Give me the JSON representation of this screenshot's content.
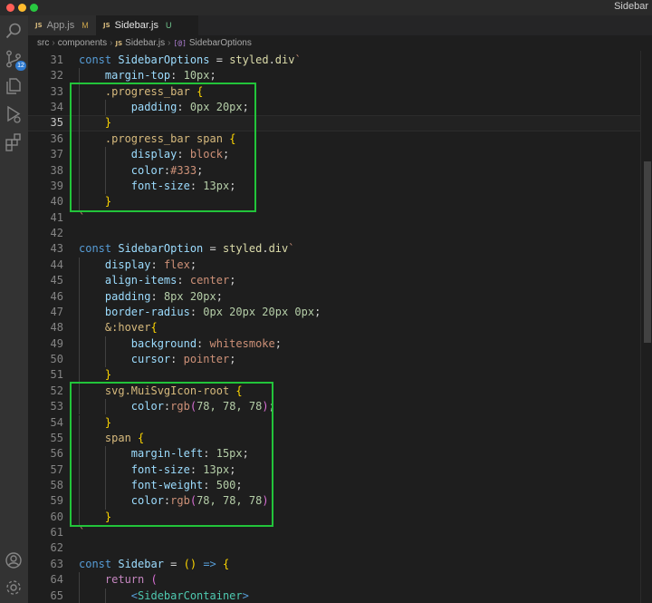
{
  "window": {
    "title": "Sidebar"
  },
  "activity_bar": {
    "icons": [
      "files-icon",
      "search-icon",
      "source-control-icon",
      "run-debug-icon",
      "extensions-icon",
      "account-icon",
      "gear-icon"
    ],
    "source_control_badge": "12"
  },
  "tabs": [
    {
      "label": "App.js",
      "status": "M",
      "active": false
    },
    {
      "label": "Sidebar.js",
      "status": "U",
      "active": true
    }
  ],
  "breadcrumb": {
    "items": [
      "src",
      "components",
      "Sidebar.js",
      "SidebarOptions"
    ]
  },
  "editor": {
    "current_line": 35,
    "lines": [
      {
        "n": "31",
        "indent": 0,
        "tokens": [
          [
            "kw",
            "const "
          ],
          [
            "name",
            "SidebarOptions"
          ],
          [
            "op",
            " = "
          ],
          [
            "func",
            "styled"
          ],
          [
            "op",
            "."
          ],
          [
            "func",
            "div"
          ],
          [
            "tmpl",
            "`"
          ]
        ]
      },
      {
        "n": "32",
        "indent": 1,
        "tokens": [
          [
            "css-prop",
            "margin-top"
          ],
          [
            "plain",
            ": "
          ],
          [
            "num",
            "10px"
          ],
          [
            "plain",
            ";"
          ]
        ]
      },
      {
        "n": "33",
        "indent": 1,
        "tokens": [
          [
            "css-sel",
            ".progress_bar"
          ],
          [
            "plain",
            " "
          ],
          [
            "brace",
            "{"
          ]
        ]
      },
      {
        "n": "34",
        "indent": 2,
        "tokens": [
          [
            "css-prop",
            "padding"
          ],
          [
            "plain",
            ": "
          ],
          [
            "num",
            "0px 20px"
          ],
          [
            "plain",
            ";"
          ]
        ]
      },
      {
        "n": "35",
        "indent": 1,
        "tokens": [
          [
            "brace",
            "}"
          ]
        ]
      },
      {
        "n": "36",
        "indent": 1,
        "tokens": [
          [
            "css-sel",
            ".progress_bar span"
          ],
          [
            "plain",
            " "
          ],
          [
            "brace",
            "{"
          ]
        ]
      },
      {
        "n": "37",
        "indent": 2,
        "tokens": [
          [
            "css-prop",
            "display"
          ],
          [
            "plain",
            ": "
          ],
          [
            "css-val",
            "block"
          ],
          [
            "plain",
            ";"
          ]
        ]
      },
      {
        "n": "38",
        "indent": 2,
        "tokens": [
          [
            "css-prop",
            "color"
          ],
          [
            "plain",
            ":"
          ],
          [
            "css-val",
            "#333"
          ],
          [
            "plain",
            ";"
          ]
        ]
      },
      {
        "n": "39",
        "indent": 2,
        "tokens": [
          [
            "css-prop",
            "font-size"
          ],
          [
            "plain",
            ": "
          ],
          [
            "num",
            "13px"
          ],
          [
            "plain",
            ";"
          ]
        ]
      },
      {
        "n": "40",
        "indent": 1,
        "tokens": [
          [
            "brace",
            "}"
          ]
        ]
      },
      {
        "n": "41",
        "indent": 0,
        "tokens": [
          [
            "tmpl",
            "`"
          ]
        ]
      },
      {
        "n": "42",
        "indent": 0,
        "tokens": []
      },
      {
        "n": "43",
        "indent": 0,
        "tokens": [
          [
            "kw",
            "const "
          ],
          [
            "name",
            "SidebarOption"
          ],
          [
            "op",
            " = "
          ],
          [
            "func",
            "styled"
          ],
          [
            "op",
            "."
          ],
          [
            "func",
            "div"
          ],
          [
            "tmpl",
            "`"
          ]
        ]
      },
      {
        "n": "44",
        "indent": 1,
        "tokens": [
          [
            "css-prop",
            "display"
          ],
          [
            "plain",
            ": "
          ],
          [
            "css-val",
            "flex"
          ],
          [
            "plain",
            ";"
          ]
        ]
      },
      {
        "n": "45",
        "indent": 1,
        "tokens": [
          [
            "css-prop",
            "align-items"
          ],
          [
            "plain",
            ": "
          ],
          [
            "css-val",
            "center"
          ],
          [
            "plain",
            ";"
          ]
        ]
      },
      {
        "n": "46",
        "indent": 1,
        "tokens": [
          [
            "css-prop",
            "padding"
          ],
          [
            "plain",
            ": "
          ],
          [
            "num",
            "8px 20px"
          ],
          [
            "plain",
            ";"
          ]
        ]
      },
      {
        "n": "47",
        "indent": 1,
        "tokens": [
          [
            "css-prop",
            "border-radius"
          ],
          [
            "plain",
            ": "
          ],
          [
            "num",
            "0px 20px 20px 0px"
          ],
          [
            "plain",
            ";"
          ]
        ]
      },
      {
        "n": "48",
        "indent": 1,
        "tokens": [
          [
            "css-sel",
            "&:hover"
          ],
          [
            "brace",
            "{"
          ]
        ]
      },
      {
        "n": "49",
        "indent": 2,
        "tokens": [
          [
            "css-prop",
            "background"
          ],
          [
            "plain",
            ": "
          ],
          [
            "css-val",
            "whitesmoke"
          ],
          [
            "plain",
            ";"
          ]
        ]
      },
      {
        "n": "50",
        "indent": 2,
        "tokens": [
          [
            "css-prop",
            "cursor"
          ],
          [
            "plain",
            ": "
          ],
          [
            "css-val",
            "pointer"
          ],
          [
            "plain",
            ";"
          ]
        ]
      },
      {
        "n": "51",
        "indent": 1,
        "tokens": [
          [
            "brace",
            "}"
          ]
        ]
      },
      {
        "n": "52",
        "indent": 1,
        "tokens": [
          [
            "css-sel",
            "svg.MuiSvgIcon-root"
          ],
          [
            "plain",
            " "
          ],
          [
            "brace",
            "{"
          ]
        ]
      },
      {
        "n": "53",
        "indent": 2,
        "tokens": [
          [
            "css-prop",
            "color"
          ],
          [
            "plain",
            ":"
          ],
          [
            "css-val",
            "rgb"
          ],
          [
            "paren",
            "("
          ],
          [
            "num",
            "78, 78, 78"
          ],
          [
            "paren",
            ")"
          ],
          [
            "plain",
            ";"
          ]
        ]
      },
      {
        "n": "54",
        "indent": 1,
        "tokens": [
          [
            "brace",
            "}"
          ]
        ]
      },
      {
        "n": "55",
        "indent": 1,
        "tokens": [
          [
            "css-sel",
            "span"
          ],
          [
            "plain",
            " "
          ],
          [
            "brace",
            "{"
          ]
        ]
      },
      {
        "n": "56",
        "indent": 2,
        "tokens": [
          [
            "css-prop",
            "margin-left"
          ],
          [
            "plain",
            ": "
          ],
          [
            "num",
            "15px"
          ],
          [
            "plain",
            ";"
          ]
        ]
      },
      {
        "n": "57",
        "indent": 2,
        "tokens": [
          [
            "css-prop",
            "font-size"
          ],
          [
            "plain",
            ": "
          ],
          [
            "num",
            "13px"
          ],
          [
            "plain",
            ";"
          ]
        ]
      },
      {
        "n": "58",
        "indent": 2,
        "tokens": [
          [
            "css-prop",
            "font-weight"
          ],
          [
            "plain",
            ": "
          ],
          [
            "num",
            "500"
          ],
          [
            "plain",
            ";"
          ]
        ]
      },
      {
        "n": "59",
        "indent": 2,
        "tokens": [
          [
            "css-prop",
            "color"
          ],
          [
            "plain",
            ":"
          ],
          [
            "css-val",
            "rgb"
          ],
          [
            "paren",
            "("
          ],
          [
            "num",
            "78, 78, 78"
          ],
          [
            "paren",
            ")"
          ]
        ]
      },
      {
        "n": "60",
        "indent": 1,
        "tokens": [
          [
            "brace",
            "}"
          ]
        ]
      },
      {
        "n": "61",
        "indent": 0,
        "tokens": [
          [
            "tmpl",
            "`"
          ]
        ]
      },
      {
        "n": "62",
        "indent": 0,
        "tokens": []
      },
      {
        "n": "63",
        "indent": 0,
        "tokens": [
          [
            "kw",
            "const "
          ],
          [
            "name",
            "Sidebar"
          ],
          [
            "op",
            " = "
          ],
          [
            "brace",
            "()"
          ],
          [
            "op",
            " "
          ],
          [
            "kw",
            "=>"
          ],
          [
            "op",
            " "
          ],
          [
            "brace",
            "{"
          ]
        ]
      },
      {
        "n": "64",
        "indent": 1,
        "tokens": [
          [
            "ctrl",
            "return"
          ],
          [
            "plain",
            " "
          ],
          [
            "paren",
            "("
          ]
        ]
      },
      {
        "n": "65",
        "indent": 2,
        "tokens": [
          [
            "tag",
            "<"
          ],
          [
            "jsx",
            "SidebarContainer"
          ],
          [
            "tag",
            ">"
          ]
        ]
      }
    ]
  },
  "annotations": {
    "highlight_color": "#22c43a",
    "boxes": [
      {
        "label": "progress-bar-styles",
        "from_line": "33",
        "to_line": "40"
      },
      {
        "label": "icon-and-span-styles",
        "from_line": "52",
        "to_line": "60"
      }
    ]
  }
}
